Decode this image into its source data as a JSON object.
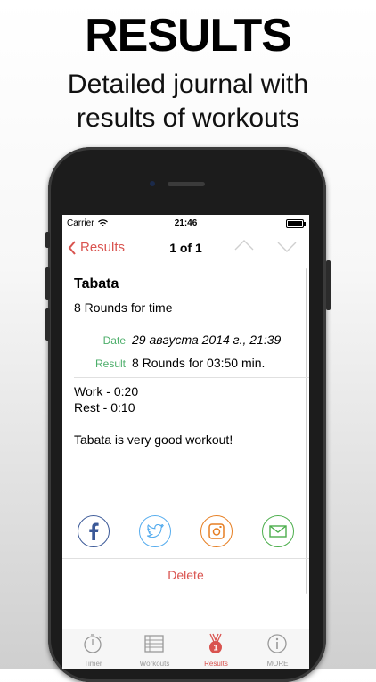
{
  "promo": {
    "headline": "RESULTS",
    "subline_1": "Detailed journal with",
    "subline_2": "results of workouts"
  },
  "status_bar": {
    "carrier": "Carrier",
    "time": "21:46"
  },
  "nav": {
    "back_label": "Results",
    "title": "1 of 1"
  },
  "entry": {
    "title": "Tabata",
    "subtitle": "8 Rounds for time",
    "date_label": "Date",
    "date_value": "29 августа 2014 г., 21:39",
    "result_label": "Result",
    "result_value": "8 Rounds for 03:50 min.",
    "notes": [
      "Work - 0:20",
      "Rest - 0:10",
      "",
      "Tabata is very good workout!"
    ]
  },
  "share": {
    "facebook_icon": "facebook-icon",
    "twitter_icon": "twitter-icon",
    "instagram_icon": "instagram-icon",
    "mail_icon": "mail-icon"
  },
  "actions": {
    "delete_label": "Delete"
  },
  "tabs": [
    {
      "label": "Timer",
      "icon": "stopwatch-icon",
      "active": false
    },
    {
      "label": "Workouts",
      "icon": "list-icon",
      "active": false
    },
    {
      "label": "Results",
      "icon": "medal-icon",
      "active": true
    },
    {
      "label": "MORE",
      "icon": "info-icon",
      "active": false
    }
  ],
  "colors": {
    "accent": "#d9534f",
    "label_green": "#4cae6a",
    "facebook": "#3b5998",
    "twitter": "#55acee",
    "instagram": "#e67e22",
    "mail": "#4cae4c"
  }
}
